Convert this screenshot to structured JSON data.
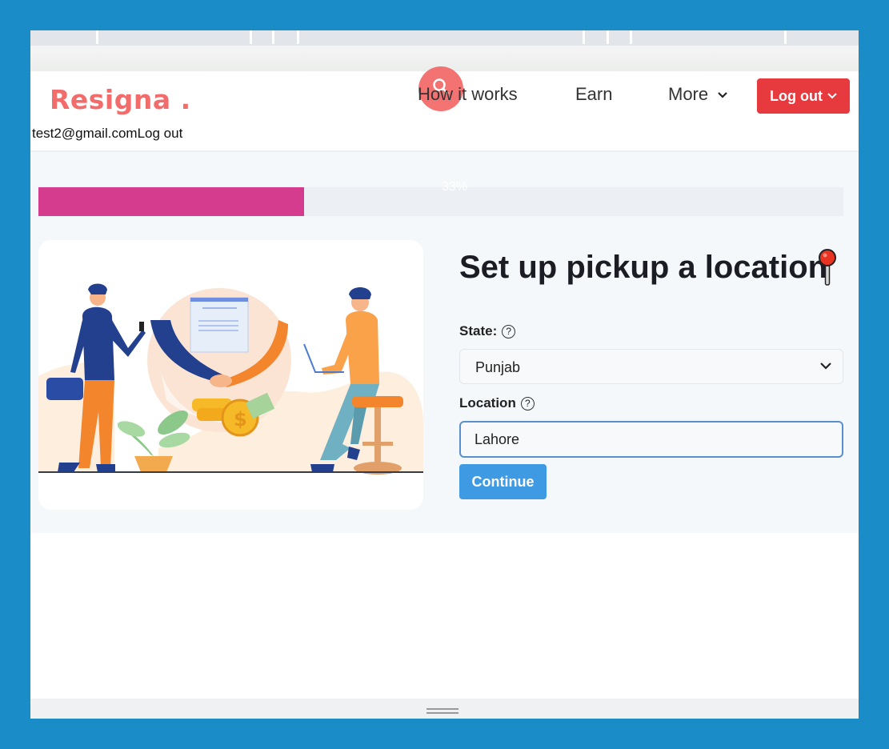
{
  "nav": {
    "logo": "Resigna .",
    "user_email": "test2@gmail.com",
    "user_logout": "Log out",
    "links": [
      "How it works",
      "Earn",
      "More"
    ],
    "logout_button": "Log out"
  },
  "progress": {
    "label": "33%",
    "value": 0.33
  },
  "form": {
    "title": "Set up pickup a location",
    "state_label": "State:",
    "state_value": "Punjab",
    "location_label": "Location",
    "location_value": "Lahore",
    "continue_label": "Continue"
  },
  "colors": {
    "accent": "#f36c6c",
    "logout": "#e63a3f",
    "progress": "#d63c8d",
    "continue": "#3d9ae3"
  },
  "icons": [
    "search-icon",
    "chevron-down-icon",
    "help-icon",
    "pin-icon"
  ]
}
